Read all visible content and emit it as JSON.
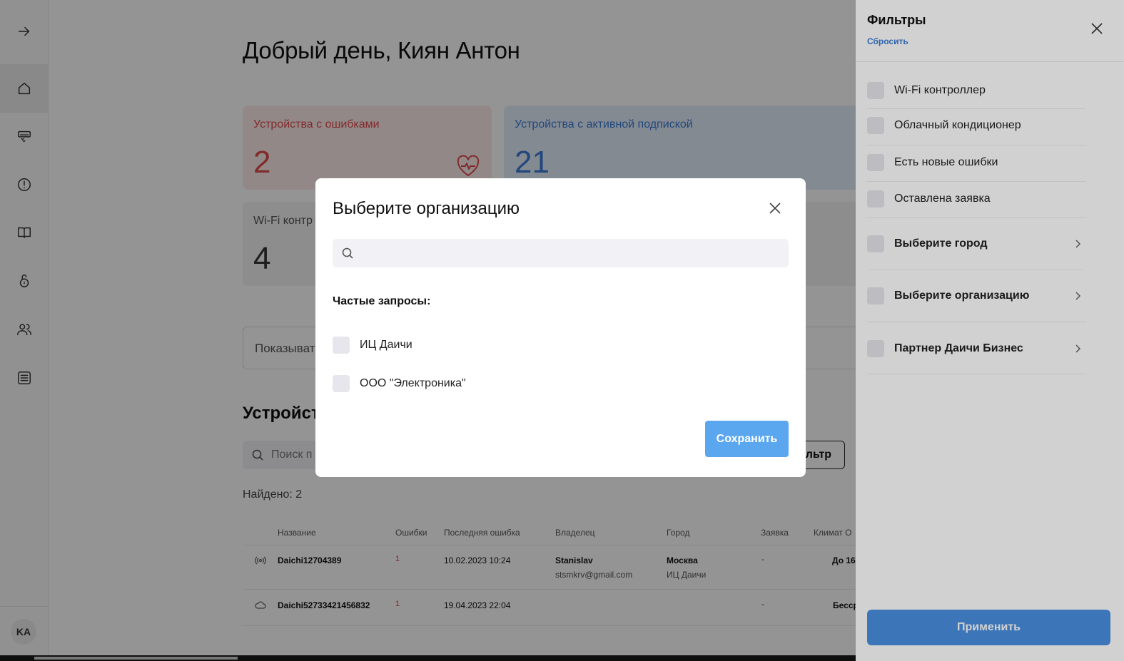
{
  "sidebar": {
    "items": [
      {
        "icon": "arrow-right-icon"
      },
      {
        "icon": "home-icon",
        "active": true
      },
      {
        "icon": "air-conditioner-icon"
      },
      {
        "icon": "alert-circle-icon"
      },
      {
        "icon": "book-icon"
      },
      {
        "icon": "lock-icon"
      },
      {
        "icon": "users-icon"
      },
      {
        "icon": "list-icon"
      }
    ],
    "avatar_initials": "KA"
  },
  "main": {
    "greeting": "Добрый день, Киян Антон",
    "cards": {
      "errors": {
        "label": "Устройства с ошибками",
        "value": "2"
      },
      "subscription": {
        "label": "Устройства с активной подпиской",
        "value": "21"
      },
      "wifi": {
        "label": "Wi-Fi контр",
        "value": "4"
      }
    },
    "show_label": "Показыват",
    "devices_title": "Устройст",
    "search_placeholder": "Поиск п",
    "filter_button": "льтр",
    "found": "Найдено: 2",
    "table": {
      "headers": [
        "Название",
        "Ошибки",
        "Последняя ошибка",
        "Владелец",
        "Город",
        "Заявка",
        "Климат О"
      ],
      "rows": [
        {
          "icon": "wifi-signal-icon",
          "name": "Daichi12704389",
          "errors": "1",
          "last_error": "10.02.2023 10:24",
          "owner": "Stanislav",
          "owner_email": "stsmkrv@gmail.com",
          "city": "Москва",
          "org": "ИЦ Даичи",
          "request": "-",
          "climate": "До 16."
        },
        {
          "icon": "cloud-icon",
          "name": "Daichi52733421456832",
          "errors": "1",
          "last_error": "19.04.2023 22:04",
          "owner": "",
          "owner_email": "",
          "city": "",
          "org": "",
          "request": "-",
          "climate": "Бесср"
        }
      ]
    }
  },
  "filters_panel": {
    "title": "Фильтры",
    "reset": "Сбросить",
    "items": [
      {
        "label": "Wi-Fi контроллер",
        "bold": false,
        "chevron": false
      },
      {
        "label": "Облачный кондиционер",
        "bold": false,
        "chevron": false
      },
      {
        "label": "Есть новые ошибки",
        "bold": false,
        "chevron": false
      },
      {
        "label": "Оставлена заявка",
        "bold": false,
        "chevron": false
      },
      {
        "label": "Выберите город",
        "bold": true,
        "chevron": true
      },
      {
        "label": "Выберите организацию",
        "bold": true,
        "chevron": true
      },
      {
        "label": "Партнер Даичи Бизнес",
        "bold": true,
        "chevron": true
      }
    ],
    "apply": "Применить"
  },
  "modal": {
    "title": "Выберите организацию",
    "search_value": "",
    "search_placeholder": "",
    "frequent_label": "Частые запросы:",
    "options": [
      "ИЦ Даичи",
      "ООО \"Электроника\""
    ],
    "save": "Сохранить"
  },
  "colors": {
    "accent_blue": "#4a90e2",
    "error_red": "#e04b4b",
    "save_blue": "#5aa7f0"
  }
}
